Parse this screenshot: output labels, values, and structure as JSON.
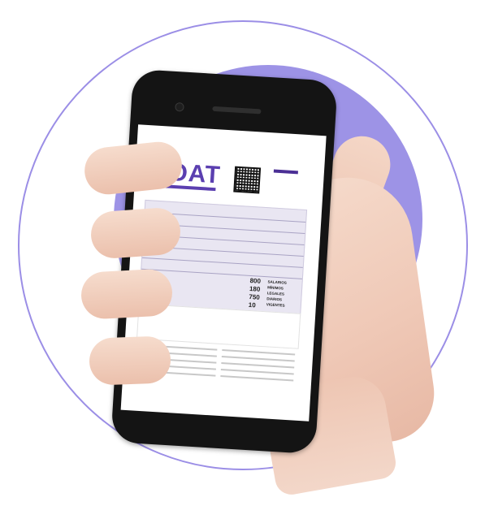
{
  "document": {
    "logo_text": "SOAT",
    "numbers": [
      "800",
      "180",
      "750",
      "10"
    ],
    "labels": [
      "SALARIOS",
      "MÍNIMOS",
      "LEGALES",
      "DIARIOS",
      "VIGENTES"
    ]
  },
  "colors": {
    "accent": "#9d93e6",
    "ring": "#9b8ee6",
    "brand": "#5b3fb0"
  },
  "icons": [
    "qr-code-icon",
    "phone-camera-icon",
    "phone-speaker-icon"
  ]
}
